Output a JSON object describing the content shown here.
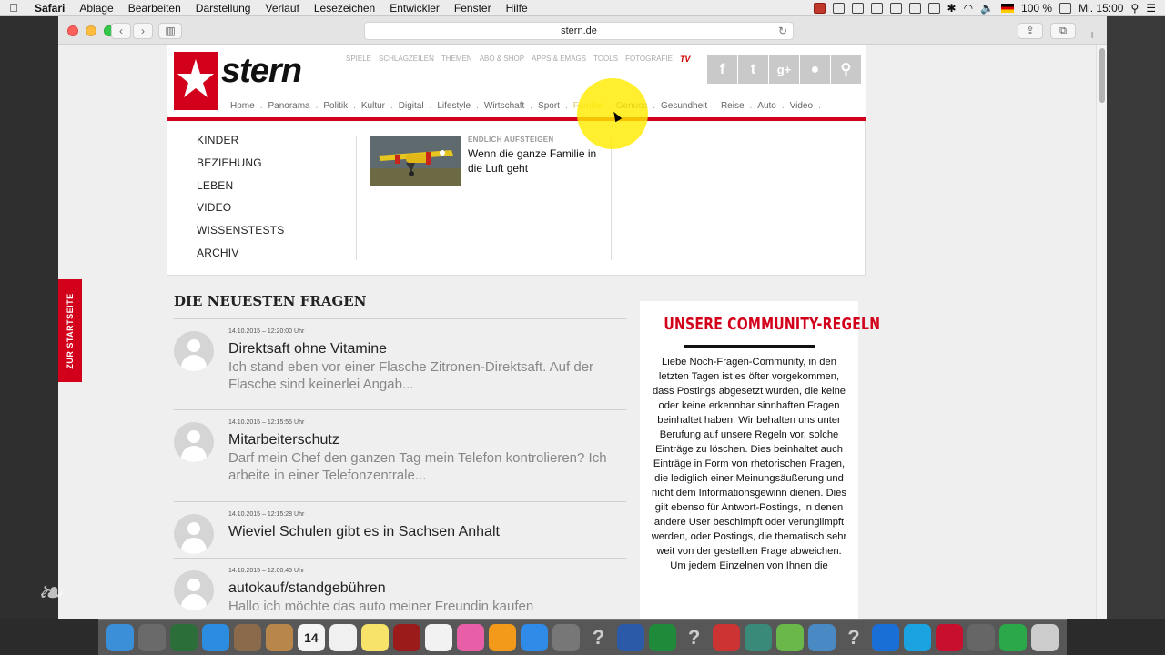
{
  "menubar": {
    "app_name": "Safari",
    "menus": [
      "Ablage",
      "Bearbeiten",
      "Darstellung",
      "Verlauf",
      "Lesezeichen",
      "Entwickler",
      "Fenster",
      "Hilfe"
    ],
    "battery": "100 %",
    "clock": "Mi. 15:00"
  },
  "browser": {
    "url": "stern.de"
  },
  "site": {
    "logo_text": "stern",
    "top_links": [
      "SPIELE",
      "SCHLAGZEILEN",
      "THEMEN",
      "ABO & SHOP",
      "APPS & EMAGS",
      "TOOLS",
      "FOTOGRAFIE"
    ],
    "tv_label": "TV",
    "social_buttons": [
      "f",
      "t",
      "g+",
      "user",
      "search"
    ],
    "nav": [
      "Home",
      "Panorama",
      "Politik",
      "Kultur",
      "Digital",
      "Lifestyle",
      "Wirtschaft",
      "Sport",
      "Familie",
      "Genuss",
      "Gesundheit",
      "Reise",
      "Auto",
      "Video"
    ],
    "active_nav_index": 8
  },
  "dropdown": {
    "items": [
      "KINDER",
      "BEZIEHUNG",
      "LEBEN",
      "VIDEO",
      "WISSENSTESTS",
      "ARCHIV"
    ],
    "teaser_kicker": "ENDLICH AUFSTEIGEN",
    "teaser_title": "Wenn die ganze Familie in die Luft geht"
  },
  "side_tab": "ZUR STARTSEITE",
  "questions": {
    "heading": "DIE NEUESTEN FRAGEN",
    "items": [
      {
        "date": "14.10.2015 – 12:20:00 Uhr",
        "title": "Direktsaft ohne Vitamine",
        "body": "Ich stand eben vor einer Flasche Zitronen-Direktsaft. Auf der Flasche sind keinerlei Angab..."
      },
      {
        "date": "14.10.2015 – 12:15:55 Uhr",
        "title": "Mitarbeiterschutz",
        "body": "Darf mein Chef den ganzen Tag mein Telefon kontrolieren? Ich arbeite in einer Telefonzentrale..."
      },
      {
        "date": "14.10.2015 – 12:15:28 Uhr",
        "title": "Wieviel Schulen gibt es in Sachsen Anhalt",
        "body": ""
      },
      {
        "date": "14.10.2015 – 12:00:45 Uhr",
        "title": "autokauf/standgebühren",
        "body": "Hallo ich möchte das auto meiner Freundin kaufen"
      }
    ]
  },
  "rules": {
    "title": "UNSERE COMMUNITY-REGELN",
    "text": "Liebe Noch-Fragen-Community, in den letzten Tagen ist es öfter vorgekommen, dass Postings abgesetzt wurden, die keine oder keine erkennbar sinnhaften Fragen beinhaltet haben. Wir behalten uns unter Berufung auf unsere Regeln vor, solche Einträge zu löschen. Dies beinhaltet auch Einträge in Form von rhetorischen Fragen, die lediglich einer Meinungsäußerung und nicht dem Informationsgewinn dienen. Dies gilt ebenso für Antwort-Postings, in denen andere User beschimpft oder verunglimpft werden, oder Postings, die thematisch sehr weit von der gestellten Frage abweichen. Um jedem Einzelnen von Ihnen die"
  },
  "dock": {
    "calendar_day": "14",
    "icons": [
      "finder-icon",
      "launchpad-icon",
      "mission-control-icon",
      "safari-icon",
      "preview-icon",
      "contacts-icon",
      "calendar-icon",
      "reminders-icon",
      "notes-icon",
      "photo-booth-icon",
      "photos-icon",
      "itunes-icon",
      "ibooks-icon",
      "app-store-icon",
      "system-preferences-icon",
      "help-icon",
      "word-icon",
      "excel-icon",
      "help-icon",
      "powerpoint-icon",
      "app-icon",
      "app-icon",
      "app-icon",
      "help-icon",
      "teamviewer-icon",
      "skype-icon",
      "acrobat-icon",
      "app-icon",
      "camtasia-icon",
      "trash-icon"
    ]
  }
}
